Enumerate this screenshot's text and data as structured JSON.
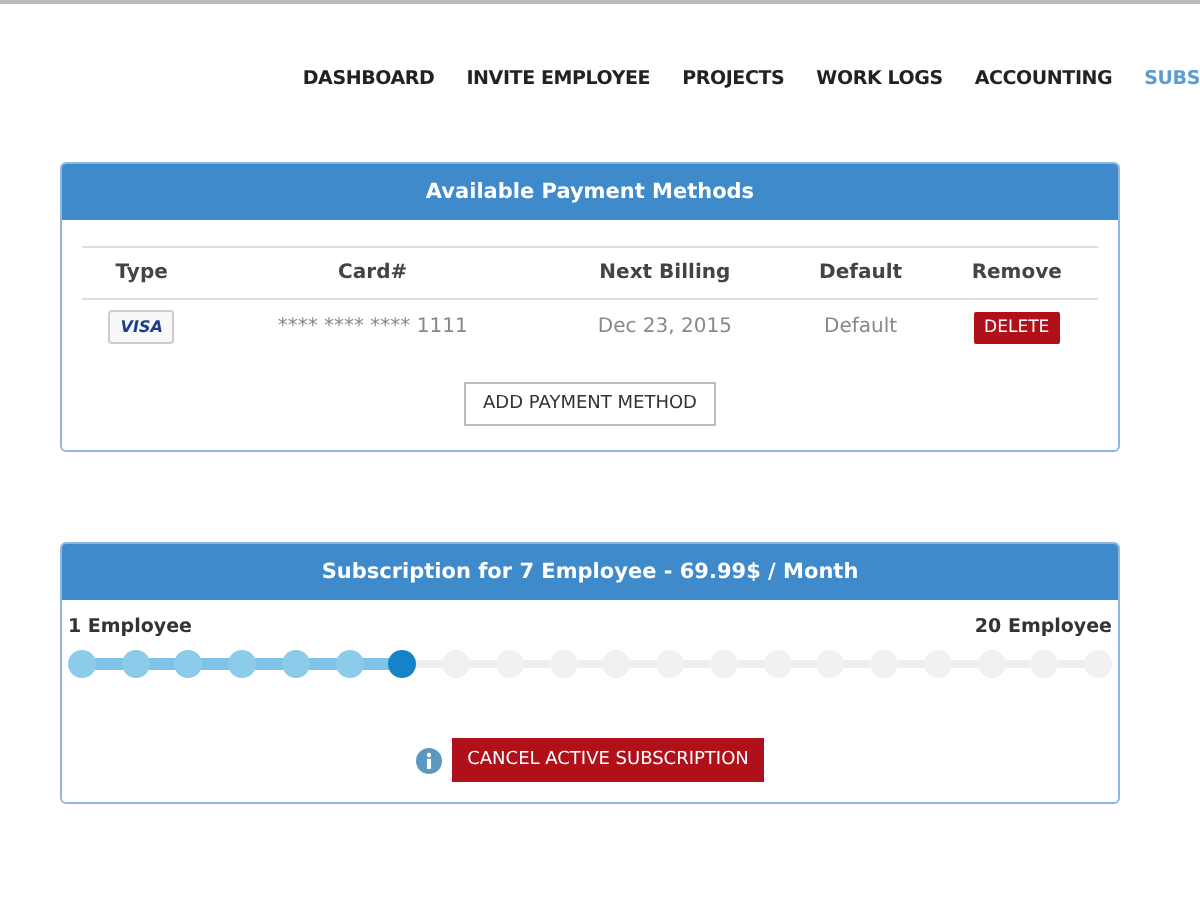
{
  "nav": [
    {
      "label": "DASHBOARD",
      "selected": false
    },
    {
      "label": "INVITE EMPLOYEE",
      "selected": false
    },
    {
      "label": "PROJECTS",
      "selected": false
    },
    {
      "label": "WORK LOGS",
      "selected": false
    },
    {
      "label": "ACCOUNTING",
      "selected": false
    },
    {
      "label": "SUBS",
      "selected": true
    }
  ],
  "payment": {
    "title": "Available Payment Methods",
    "columns": [
      "Type",
      "Card#",
      "Next Billing",
      "Default",
      "Remove"
    ],
    "rows": [
      {
        "card_type": "VISA",
        "card": "**** **** **** 1111",
        "next_billing": "Dec 23, 2015",
        "default": "Default",
        "remove": "DELETE"
      }
    ],
    "add_button": "ADD PAYMENT METHOD"
  },
  "subscription": {
    "title": "Subscription for 7 Employee - 69.99$ / Month",
    "min_label": "1 Employee",
    "max_label": "20 Employee",
    "level": 0.3158,
    "cancel_button": "CANCEL ACTIVE SUBSCRIPTION"
  }
}
